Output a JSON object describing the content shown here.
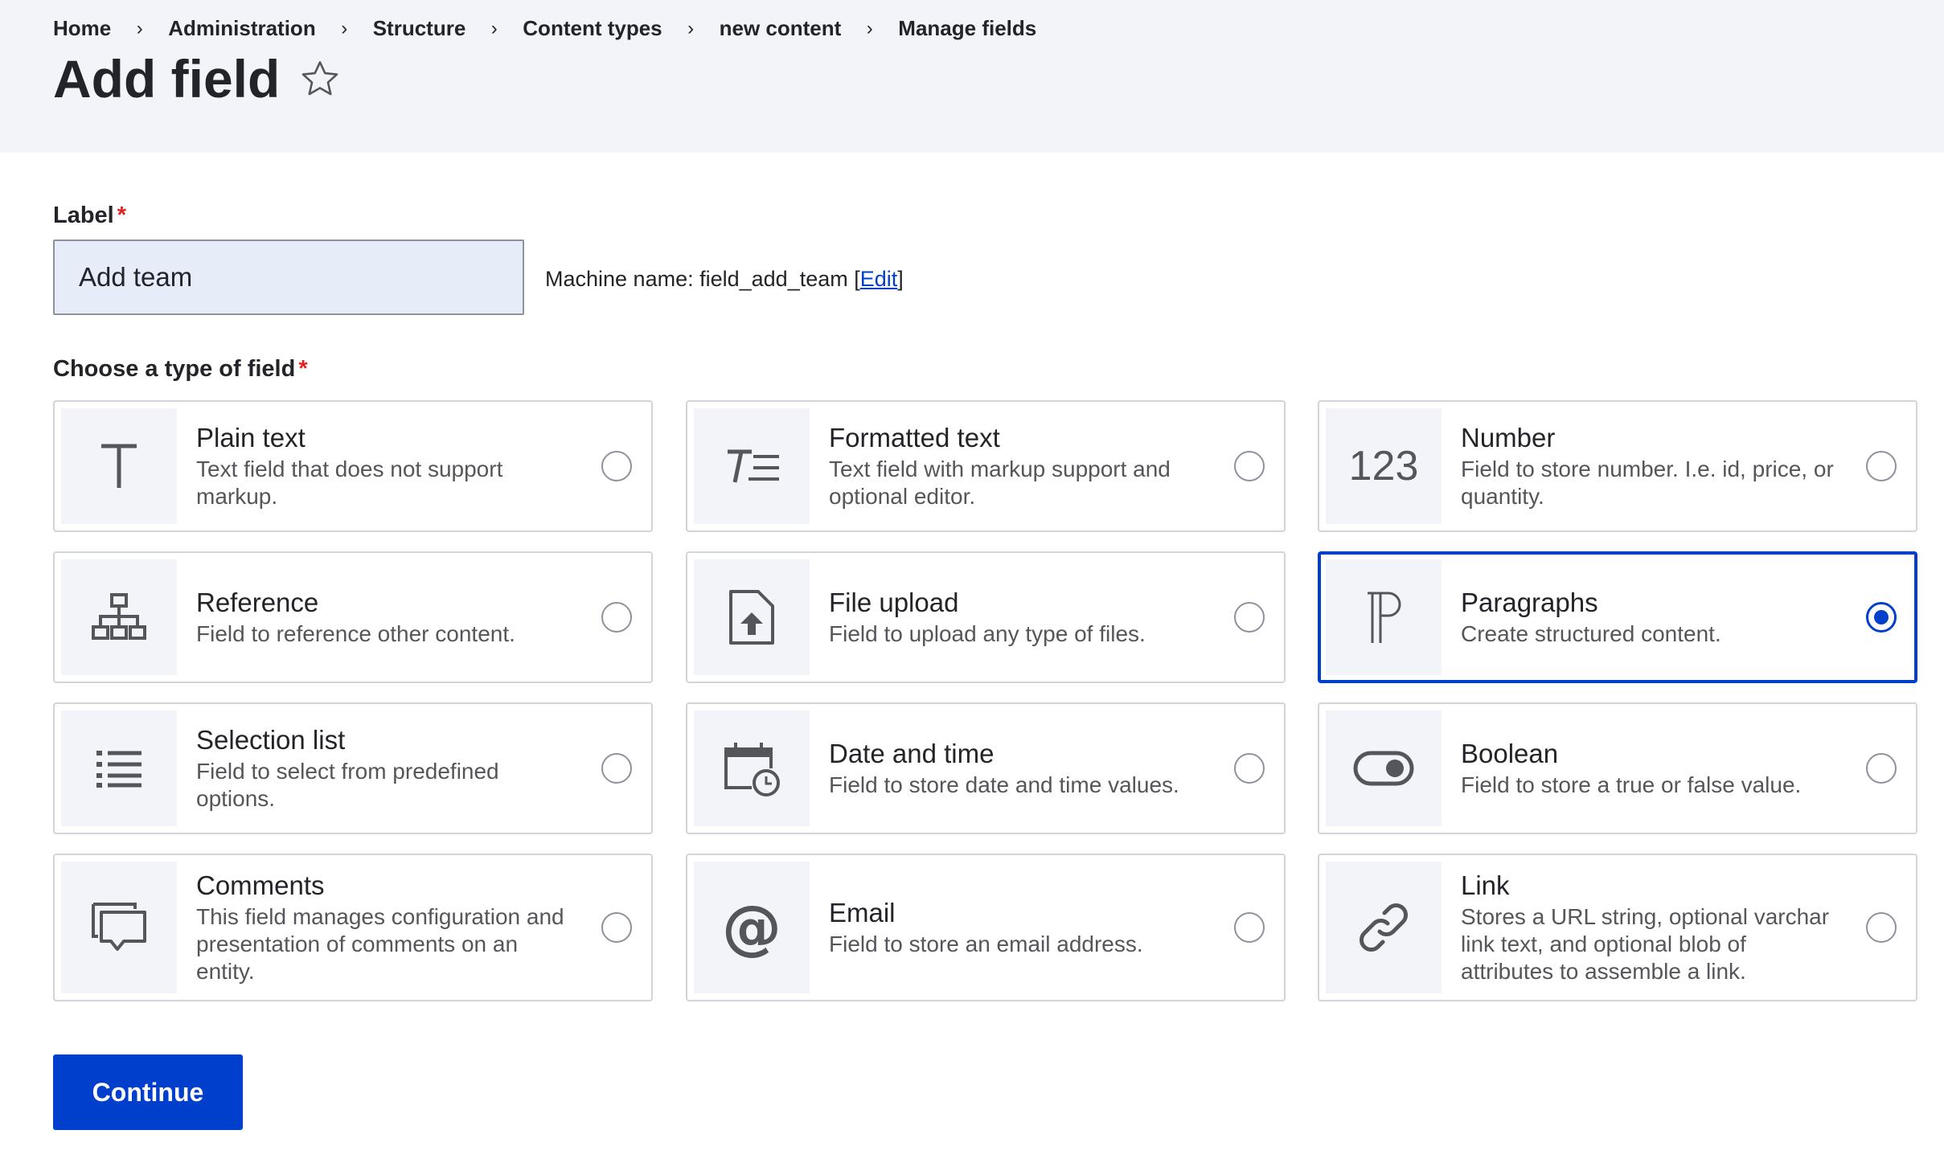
{
  "breadcrumb": [
    {
      "label": "Home"
    },
    {
      "label": "Administration"
    },
    {
      "label": "Structure"
    },
    {
      "label": "Content types"
    },
    {
      "label": "new content"
    },
    {
      "label": "Manage fields"
    }
  ],
  "breadcrumb_separator": "›",
  "page": {
    "title": "Add field",
    "favorite_icon": "star-outline-icon"
  },
  "label_field": {
    "label": "Label",
    "required_mark": "*",
    "value": "Add team",
    "machine_name_prefix": "Machine name: field_add_team [",
    "edit_link": "Edit",
    "machine_name_suffix": "]"
  },
  "field_type": {
    "label": "Choose a type of field",
    "required_mark": "*",
    "options": [
      {
        "title": "Plain text",
        "description": "Text field that does not support markup.",
        "icon": "plain-text-icon",
        "selected": false
      },
      {
        "title": "Formatted text",
        "description": "Text field with markup support and optional editor.",
        "icon": "formatted-text-icon",
        "selected": false
      },
      {
        "title": "Number",
        "description": "Field to store number. I.e. id, price, or quantity.",
        "icon": "number-icon",
        "icon_text": "123",
        "selected": false
      },
      {
        "title": "Reference",
        "description": "Field to reference other content.",
        "icon": "reference-icon",
        "selected": false
      },
      {
        "title": "File upload",
        "description": "Field to upload any type of files.",
        "icon": "file-upload-icon",
        "selected": false
      },
      {
        "title": "Paragraphs",
        "description": "Create structured content.",
        "icon": "paragraphs-icon",
        "selected": true
      },
      {
        "title": "Selection list",
        "description": "Field to select from predefined options.",
        "icon": "selection-list-icon",
        "selected": false
      },
      {
        "title": "Date and time",
        "description": "Field to store date and time values.",
        "icon": "date-time-icon",
        "selected": false
      },
      {
        "title": "Boolean",
        "description": "Field to store a true or false value.",
        "icon": "boolean-toggle-icon",
        "selected": false
      },
      {
        "title": "Comments",
        "description": "This field manages configuration and presentation of comments on an entity.",
        "icon": "comments-icon",
        "selected": false
      },
      {
        "title": "Email",
        "description": "Field to store an email address.",
        "icon": "email-at-icon",
        "icon_text": "@",
        "selected": false
      },
      {
        "title": "Link",
        "description": "Stores a URL string, optional varchar link text, and optional blob of attributes to assemble a link.",
        "icon": "link-icon",
        "selected": false
      }
    ]
  },
  "actions": {
    "continue_label": "Continue"
  },
  "colors": {
    "accent": "#003ecc",
    "required": "#dc2323",
    "header_bg": "#f3f4f9",
    "input_bg": "#e6ecf8"
  }
}
